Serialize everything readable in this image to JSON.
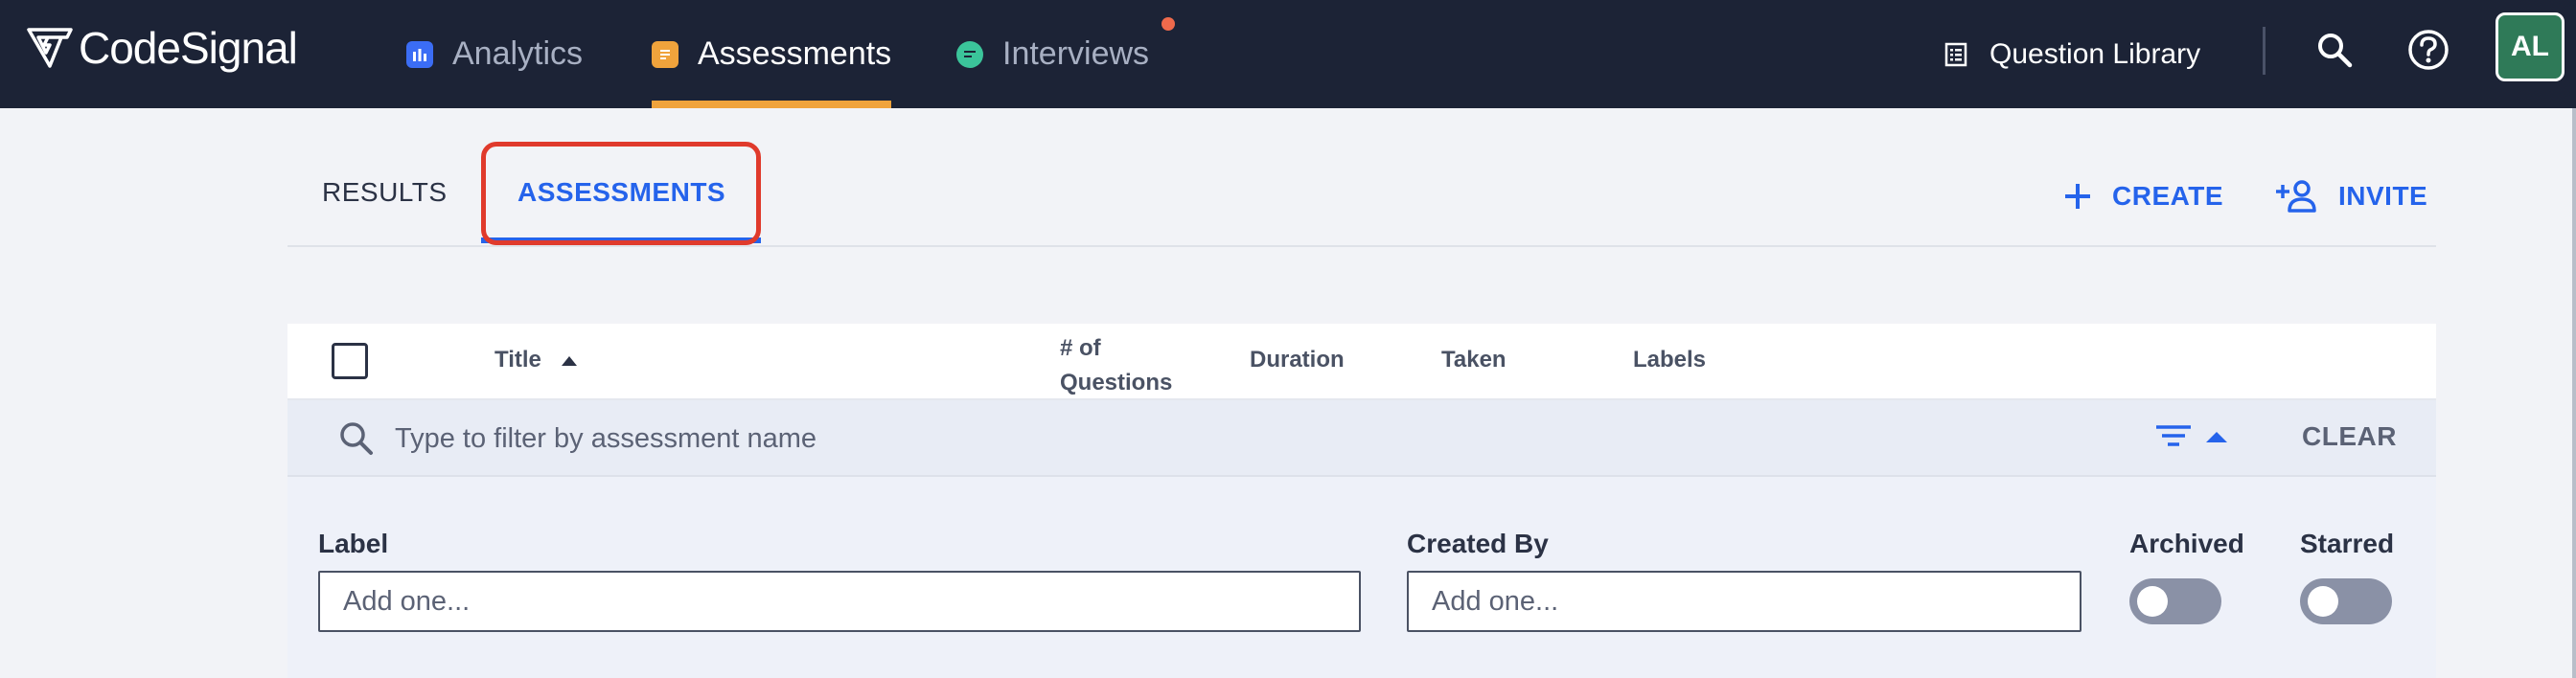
{
  "brand": {
    "name": "CodeSignal"
  },
  "nav": {
    "analytics": "Analytics",
    "assessments": "Assessments",
    "interviews": "Interviews",
    "question_library": "Question Library",
    "avatar_initials": "AL"
  },
  "tabs": {
    "results": "RESULTS",
    "assessments": "ASSESSMENTS"
  },
  "actions": {
    "create": "CREATE",
    "invite": "INVITE"
  },
  "table": {
    "columns": {
      "title": "Title",
      "questions": "# of Questions",
      "duration": "Duration",
      "taken": "Taken",
      "labels": "Labels"
    },
    "sort": {
      "column": "Title",
      "direction": "ascending"
    }
  },
  "filter": {
    "placeholder": "Type to filter by assessment name",
    "clear": "CLEAR"
  },
  "filter_panel": {
    "label": {
      "title": "Label",
      "placeholder": "Add one..."
    },
    "created_by": {
      "title": "Created By",
      "placeholder": "Add one..."
    },
    "archived": {
      "title": "Archived",
      "on": false
    },
    "starred": {
      "title": "Starred",
      "on": false
    }
  },
  "colors": {
    "navbar": "#1c2336",
    "accent": "#2563eb",
    "highlight_box": "#e03a2c",
    "active_nav_underline": "#f0a33c",
    "avatar_bg": "#2f7a58"
  }
}
